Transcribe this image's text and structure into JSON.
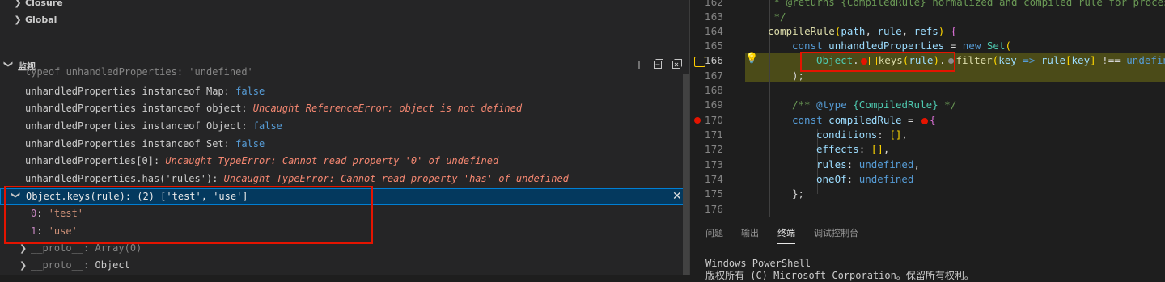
{
  "scopes": [
    {
      "label": "Closure"
    },
    {
      "label": "Global"
    }
  ],
  "watch": {
    "title": "监视",
    "header_buttons": [
      "add-icon",
      "collapse-all-icon",
      "remove-all-icon"
    ],
    "lines": [
      {
        "expr": "typeof unhandledProperties",
        "sep": ": ",
        "value": "'undefined'",
        "kind": "str",
        "clipped": true
      },
      {
        "expr": "unhandledProperties instanceof Map",
        "sep": ": ",
        "value": "false",
        "kind": "bool"
      },
      {
        "expr": "unhandledProperties instanceof object",
        "sep": ": ",
        "value": "Uncaught ReferenceError: object is not defined",
        "kind": "err"
      },
      {
        "expr": "unhandledProperties instanceof Object",
        "sep": ": ",
        "value": "false",
        "kind": "bool"
      },
      {
        "expr": "unhandledProperties instanceof Set",
        "sep": ": ",
        "value": "false",
        "kind": "bool"
      },
      {
        "expr": "unhandledProperties[0]",
        "sep": ": ",
        "value": "Uncaught TypeError: Cannot read property '0' of undefined",
        "kind": "err"
      },
      {
        "expr": "unhandledProperties.has('rules')",
        "sep": ": ",
        "value": "Uncaught TypeError: Cannot read property 'has' of undefined",
        "kind": "err"
      }
    ],
    "selected": {
      "text": "Object.keys(rule): (2) ['test', 'use']",
      "close": "✕"
    },
    "children": [
      {
        "key": "0",
        "value": "'test'"
      },
      {
        "key": "1",
        "value": "'use'"
      }
    ],
    "protos": [
      {
        "key": "__proto__",
        "value": "Array(0)"
      },
      {
        "key": "__proto__",
        "value": "Object"
      }
    ]
  },
  "editor": {
    "lines": [
      {
        "num": "162",
        "text": " * @returns {CompiledRule} normalized and compiled rule for processing"
      },
      {
        "num": "163",
        "text": " */"
      },
      {
        "num": "164",
        "text": "compileRule(path, rule, refs) {"
      },
      {
        "num": "165",
        "text": "const unhandledProperties = new Set("
      },
      {
        "num": "166",
        "text": "Object.keys(rule).filter(key => rule[key] !== undefined)"
      },
      {
        "num": "167",
        "text": ");"
      },
      {
        "num": "168",
        "text": ""
      },
      {
        "num": "169",
        "text": "/** @type {CompiledRule} */"
      },
      {
        "num": "170",
        "text": "const compiledRule = {"
      },
      {
        "num": "171",
        "text": "conditions: [],"
      },
      {
        "num": "172",
        "text": "effects: [],"
      },
      {
        "num": "173",
        "text": "rules: undefined,"
      },
      {
        "num": "174",
        "text": "oneOf: undefined"
      },
      {
        "num": "175",
        "text": "};"
      },
      {
        "num": "176",
        "text": ""
      }
    ],
    "current_line": "166",
    "breakpoint_line": "170"
  },
  "panel": {
    "tabs": [
      "问题",
      "输出",
      "终端",
      "调试控制台"
    ],
    "active_tab": "终端",
    "terminal_lines": [
      "Windows PowerShell",
      "版权所有 (C) Microsoft Corporation。保留所有权利。"
    ]
  },
  "colors": {
    "accent": "#007fd4",
    "annotation_red": "#e51400",
    "current_line_bg": "#4b4b18"
  }
}
